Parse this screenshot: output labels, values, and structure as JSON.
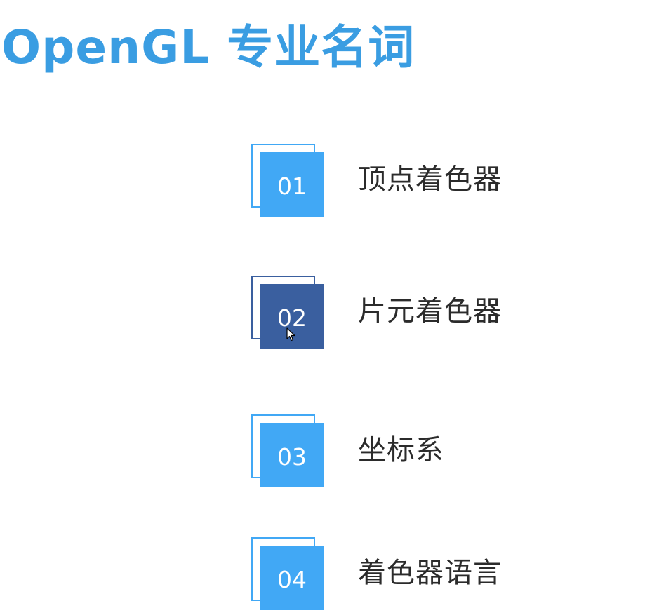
{
  "page": {
    "title": "OpenGL 专业名词",
    "title_color": "#3a9de2"
  },
  "colors": {
    "accent": "#41a8f5",
    "active": "#3a5f9f",
    "text": "#2b2b2b"
  },
  "items": [
    {
      "number": "01",
      "label": "顶点着色器",
      "active": false
    },
    {
      "number": "02",
      "label": "片元着色器",
      "active": true
    },
    {
      "number": "03",
      "label": "坐标系",
      "active": false
    },
    {
      "number": "04",
      "label": "着色器语言",
      "active": false
    }
  ],
  "cursor": {
    "icon": "mouse-pointer-icon"
  }
}
